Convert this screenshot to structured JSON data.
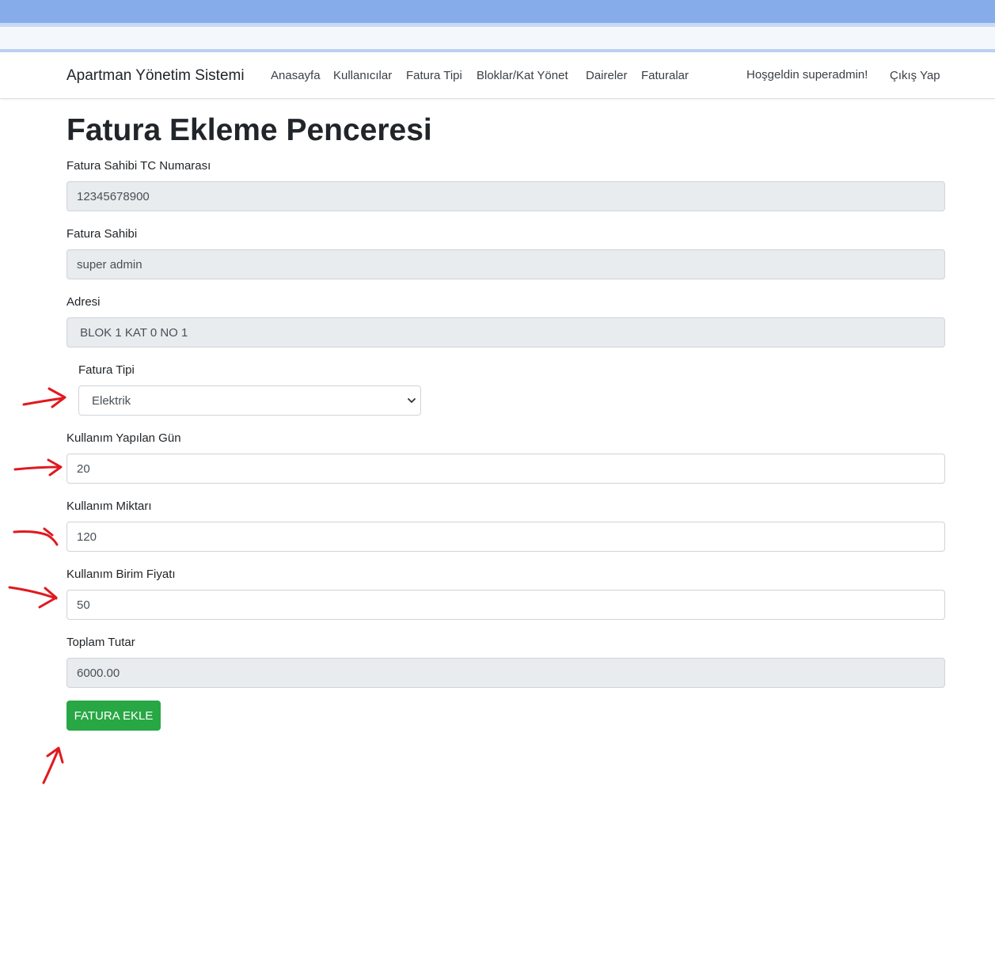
{
  "navbar": {
    "brand": "Apartman Yönetim Sistemi",
    "links": [
      "Anasayfa",
      "Kullanıcılar",
      "Fatura Tipi",
      "Bloklar/Kat Yönet",
      "Daireler",
      "Faturalar"
    ],
    "welcome": "Hoşgeldin superadmin!",
    "logout": "Çıkış Yap"
  },
  "page": {
    "title": "Fatura Ekleme Penceresi"
  },
  "form": {
    "tc": {
      "label": "Fatura Sahibi TC Numarası",
      "value": "12345678900"
    },
    "owner": {
      "label": "Fatura Sahibi",
      "value": "super admin"
    },
    "address": {
      "label": "Adresi",
      "value": " BLOK 1 KAT 0 NO 1"
    },
    "type": {
      "label": "Fatura Tipi",
      "selected": "Elektrik"
    },
    "days": {
      "label": "Kullanım Yapılan Gün",
      "value": "20"
    },
    "amount": {
      "label": "Kullanım Miktarı",
      "value": "120"
    },
    "unit_price": {
      "label": "Kullanım Birim Fiyatı",
      "value": "50"
    },
    "total": {
      "label": "Toplam Tutar",
      "value": "6000.00"
    },
    "submit": "FATURA EKLE"
  },
  "colors": {
    "submit": "#28a745",
    "readonly_bg": "#e9ecef",
    "annotation": "#e0191e",
    "browser_top": "#86adea"
  },
  "icons": {
    "select": "chevron-down-icon"
  }
}
